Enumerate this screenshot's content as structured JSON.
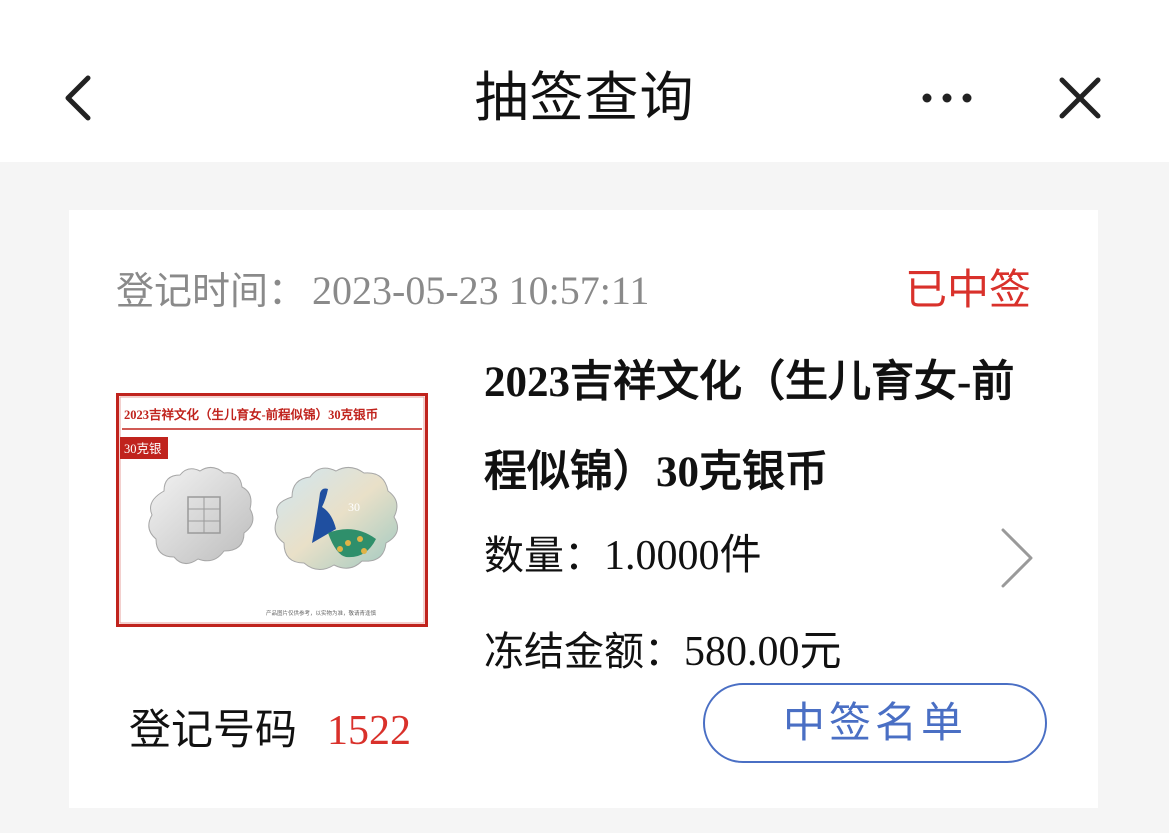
{
  "header": {
    "title": "抽签查询"
  },
  "record": {
    "reg_time_label": "登记时间：",
    "reg_time_value": "2023-05-23 10:57:11",
    "status": "已中签",
    "product_title": "2023吉祥文化（生儿育女-前程似锦）30克银币",
    "quantity_label": "数量：",
    "quantity_value": "1.0000件",
    "freeze_label": "冻结金额：",
    "freeze_value": "580.00元",
    "reg_no_label": "登记号码",
    "reg_no_value": "1522",
    "winners_button": "中签名单"
  },
  "thumbnail": {
    "banner_text": "2023吉祥文化（生儿育女-前程似锦）30克银币",
    "badge_text": "30克银",
    "footnote": "产品图片仅供参考，以实物为准，敬请青逢慎"
  },
  "colors": {
    "accent_red": "#d9312b",
    "link_blue": "#4a6fc4",
    "muted_gray": "#8a8a8a"
  }
}
